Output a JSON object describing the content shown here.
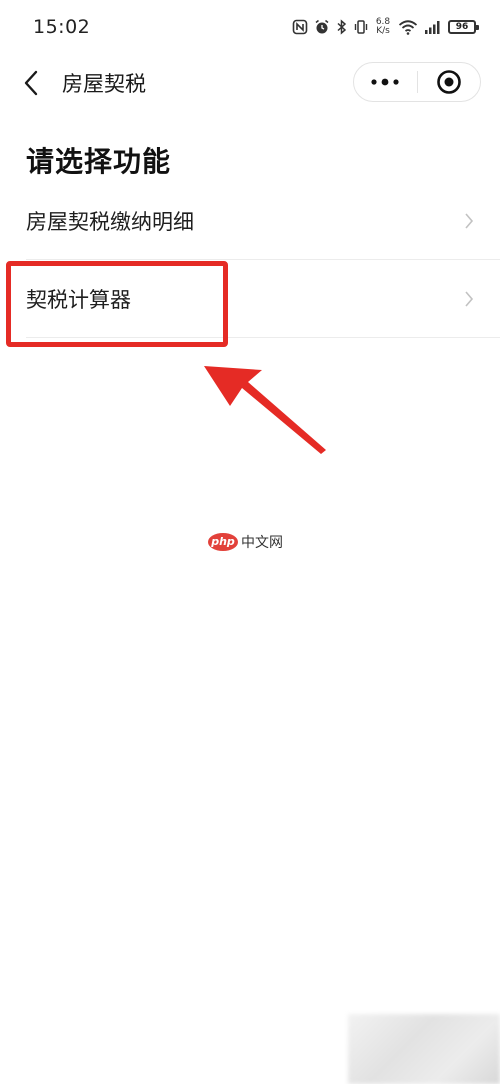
{
  "status_bar": {
    "time": "15:02",
    "net_speed_value": "6.8",
    "net_speed_unit": "K/s",
    "battery": "96",
    "icons": [
      "nfc-icon",
      "alarm-icon",
      "bluetooth-icon",
      "vibrate-icon",
      "wifi-icon",
      "signal-icon",
      "battery-icon"
    ]
  },
  "nav": {
    "title": "房屋契税",
    "icons": [
      "back-arrow-icon",
      "more-dots-icon",
      "close-circle-icon"
    ]
  },
  "page": {
    "section_title": "请选择功能",
    "items": [
      {
        "label": "房屋契税缴纳明细"
      },
      {
        "label": "契税计算器"
      }
    ]
  },
  "annotation": {
    "highlight_color": "#e52b25",
    "highlighted_item_index": 1
  },
  "watermark": {
    "logo": "php",
    "text": "中文网"
  }
}
